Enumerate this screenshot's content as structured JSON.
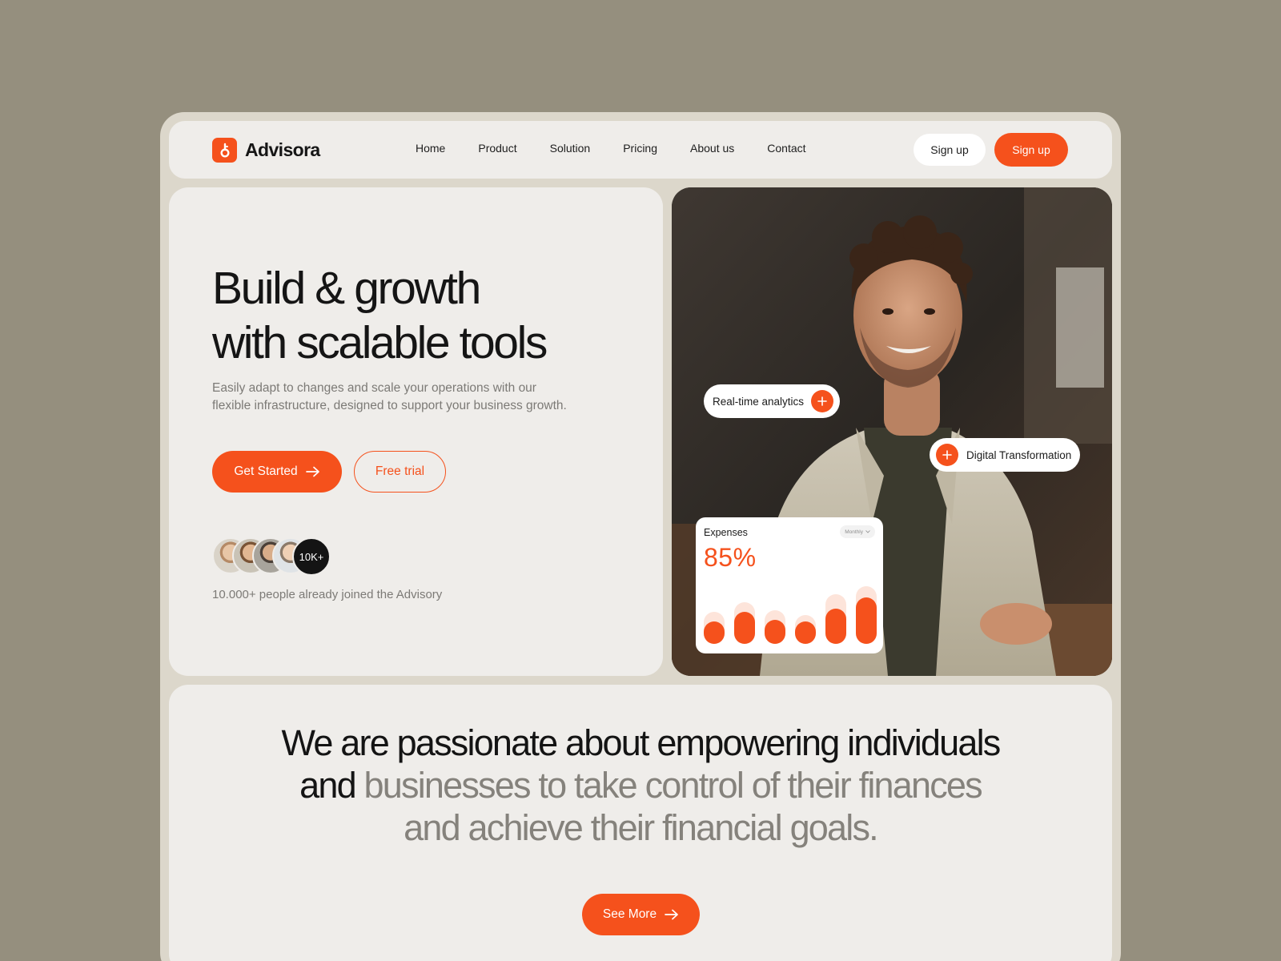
{
  "brand": {
    "name": "Advisora"
  },
  "nav": {
    "links": [
      "Home",
      "Product",
      "Solution",
      "Pricing",
      "About us",
      "Contact"
    ],
    "signup_ghost": "Sign up",
    "signup_solid": "Sign up"
  },
  "hero": {
    "title_line1": "Build & growth",
    "title_line2": "with scalable tools",
    "description_line1": "Easily adapt to changes and scale your operations with our",
    "description_line2": "flexible infrastructure, designed to support your business growth.",
    "cta_primary": "Get Started",
    "cta_secondary": "Free trial",
    "avatar_count": "10K+",
    "joined_text": "10.000+ people already joined the Advisory"
  },
  "photo_overlay": {
    "chip_analytics": "Real-time analytics",
    "chip_transformation": "Digital Transformation",
    "expenses": {
      "title": "Expenses",
      "period": "Monthly",
      "value": "85%",
      "bars": [
        0.28,
        0.4,
        0.3,
        0.28,
        0.44,
        0.58
      ],
      "bars_bg": [
        0.4,
        0.52,
        0.42,
        0.36,
        0.62,
        0.72
      ]
    }
  },
  "mission": {
    "text_dark_1": "We are passionate about empowering individuals",
    "text_dark_2": "and",
    "text_grey_1": "businesses to take control of their finances",
    "text_grey_2": "and achieve their financial goals.",
    "cta": "See More"
  },
  "colors": {
    "accent": "#f5511c",
    "background": "#958f7e",
    "frame": "#dcd7cb",
    "card": "#efedea"
  }
}
